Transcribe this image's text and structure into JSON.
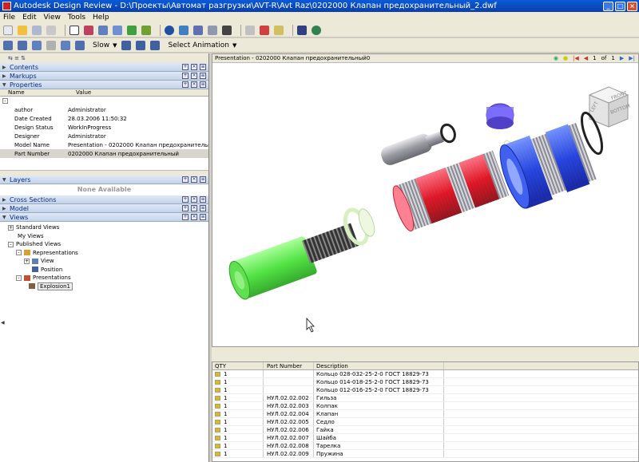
{
  "window": {
    "title": "Autodesk Design Review - D:\\Проекты\\Автомат разгрузки\\AVT-R\\Avt Raz\\0202000 Клапан предохранительный_2.dwf"
  },
  "menu": [
    "File",
    "Edit",
    "View",
    "Tools",
    "Help"
  ],
  "toolbar2": {
    "animation_speed": "Slow",
    "select_animation": "Select Animation"
  },
  "panels": {
    "contents": "Contents",
    "markups": "Markups",
    "properties": "Properties",
    "layers": "Layers",
    "cross_sections": "Cross Sections",
    "model": "Model",
    "views": "Views"
  },
  "properties": {
    "col_name": "Name",
    "col_value": "Value",
    "rows": [
      {
        "k": "author",
        "v": "Administrator"
      },
      {
        "k": "Date Created",
        "v": "28.03.2006 11:50:32"
      },
      {
        "k": "Design Status",
        "v": "WorkInProgress"
      },
      {
        "k": "Designer",
        "v": "Administrator"
      },
      {
        "k": "Model Name",
        "v": "Presentation - 0202000 Клапан предохранительный0"
      },
      {
        "k": "Part Number",
        "v": "0202000 Клапан предохранительный"
      }
    ]
  },
  "layers": {
    "empty": "None Available"
  },
  "views_tree": {
    "standard": "Standard Views",
    "my": "My Views",
    "published": "Published Views",
    "representations": "Representations",
    "view": "View",
    "position": "Position",
    "presentations": "Presentations",
    "explosion": "Explosion1"
  },
  "viewport": {
    "title": "Presentation - 0202000 Клапан предохранительный0",
    "page": "1",
    "of_label": "of",
    "page_count": "1",
    "cube_front": "FRONT",
    "cube_bottom": "BOTTOM",
    "cube_left": "LEFT"
  },
  "bom": {
    "headers": [
      "QTY",
      "Part Number",
      "Description"
    ],
    "rows": [
      {
        "qty": "1",
        "pn": "",
        "desc": "Кольцо 028-032-25-2-0 ГОСТ 18829-73"
      },
      {
        "qty": "1",
        "pn": "",
        "desc": "Кольцо 014-018-25-2-0 ГОСТ 18829-73"
      },
      {
        "qty": "1",
        "pn": "",
        "desc": "Кольцо 012-016-25-2-0 ГОСТ 18829-73"
      },
      {
        "qty": "1",
        "pn": "НУЛ.02.02.002",
        "desc": "Гильза"
      },
      {
        "qty": "1",
        "pn": "НУЛ.02.02.003",
        "desc": "Колпак"
      },
      {
        "qty": "1",
        "pn": "НУЛ.02.02.004",
        "desc": "Клапан"
      },
      {
        "qty": "1",
        "pn": "НУЛ.02.02.005",
        "desc": "Седло"
      },
      {
        "qty": "1",
        "pn": "НУЛ.02.02.006",
        "desc": "Гайка"
      },
      {
        "qty": "1",
        "pn": "НУЛ.02.02.007",
        "desc": "Шайба"
      },
      {
        "qty": "1",
        "pn": "НУЛ.02.02.008",
        "desc": "Тарелка"
      },
      {
        "qty": "1",
        "pn": "НУЛ.02.02.009",
        "desc": "Пружина"
      }
    ]
  }
}
